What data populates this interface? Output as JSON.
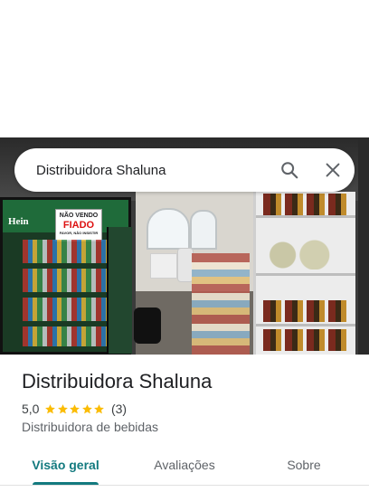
{
  "search": {
    "query": "Distribuidora Shaluna",
    "search_icon": "search-icon",
    "close_icon": "close-icon"
  },
  "photo": {
    "sign_line1": "NÃO VENDO",
    "sign_line2": "FIADO",
    "sign_line3": "FAVOR, NÃO INSISTIR",
    "fridge_brand": "Hein"
  },
  "place": {
    "name": "Distribuidora Shaluna",
    "rating": "5,0",
    "stars": 5,
    "review_count": "(3)",
    "category": "Distribuidora de bebidas"
  },
  "tabs": [
    {
      "label": "Visão geral",
      "active": true
    },
    {
      "label": "Avaliações",
      "active": false
    },
    {
      "label": "Sobre",
      "active": false
    }
  ],
  "colors": {
    "accent": "#137a7f",
    "star": "#fbbc04"
  }
}
